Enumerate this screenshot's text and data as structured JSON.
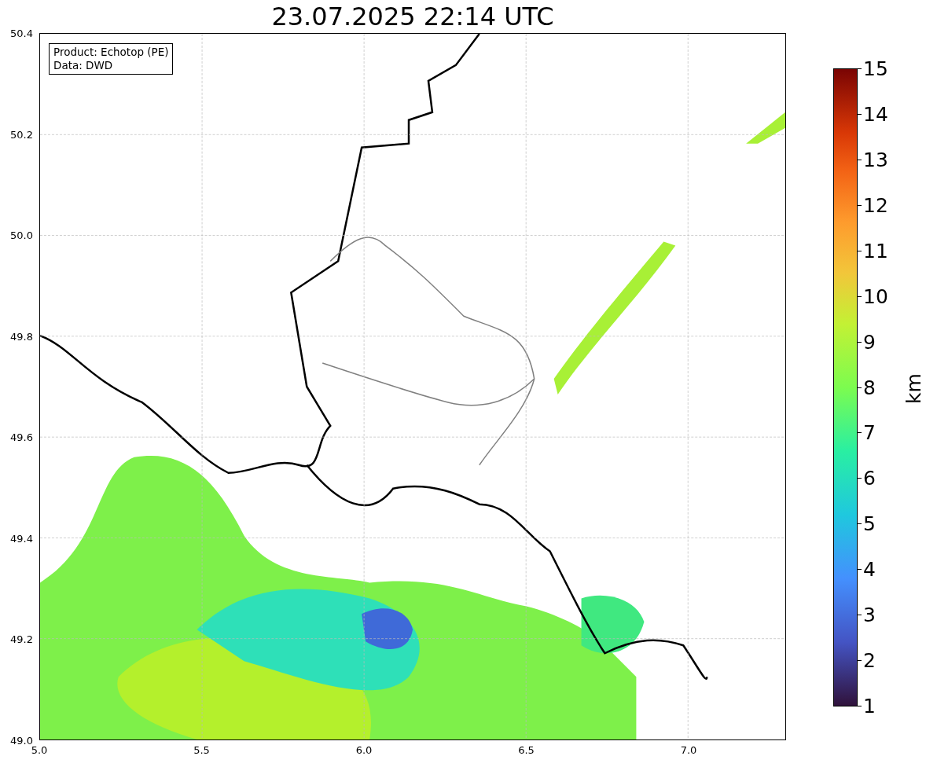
{
  "title": "23.07.2025 22:14 UTC",
  "legend": [
    "Product: Echotop (PE)",
    "Data: DWD"
  ],
  "x_ticks": [
    "5.0",
    "5.5",
    "6.0",
    "6.5",
    "7.0"
  ],
  "y_ticks": [
    "50.4",
    "50.2",
    "50.0",
    "49.8",
    "49.6",
    "49.4",
    "49.2",
    "49.0"
  ],
  "colorbar": {
    "label": "km",
    "ticks": [
      "15",
      "14",
      "13",
      "12",
      "11",
      "10",
      "9",
      "8",
      "7",
      "6",
      "5",
      "4",
      "3",
      "2",
      "1"
    ]
  }
}
